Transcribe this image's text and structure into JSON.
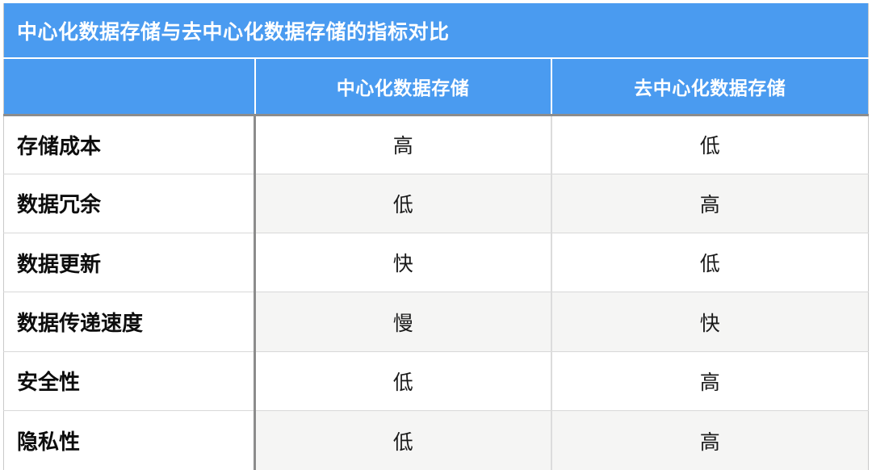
{
  "table": {
    "title": "中心化数据存储与去中心化数据存储的指标对比",
    "accent_color": "#4a9bf0",
    "header_text_color": "#ffffff",
    "stripe_color": "#f5f5f4",
    "columns": [
      {
        "key": "metric",
        "label": ""
      },
      {
        "key": "centralized",
        "label": "中心化数据存储"
      },
      {
        "key": "decentralized",
        "label": "去中心化数据存储"
      }
    ],
    "rows": [
      {
        "metric": "存储成本",
        "centralized": "高",
        "decentralized": "低",
        "striped": false
      },
      {
        "metric": "数据冗余",
        "centralized": "低",
        "decentralized": "高",
        "striped": true
      },
      {
        "metric": "数据更新",
        "centralized": "快",
        "decentralized": "低",
        "striped": false
      },
      {
        "metric": "数据传递速度",
        "centralized": "慢",
        "decentralized": "快",
        "striped": true
      },
      {
        "metric": "安全性",
        "centralized": "低",
        "decentralized": "高",
        "striped": false
      },
      {
        "metric": "隐私性",
        "centralized": "低",
        "decentralized": "高",
        "striped": true
      }
    ]
  }
}
